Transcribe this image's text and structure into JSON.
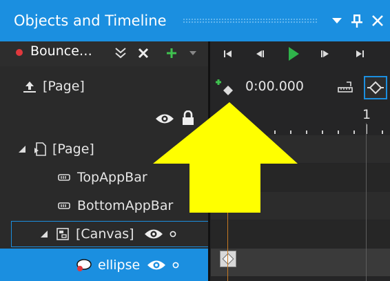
{
  "panel": {
    "title": "Objects and Timeline",
    "menu_icon": "caret-down",
    "pin_icon": "pin",
    "close_icon": "close"
  },
  "storyboard": {
    "name": "Bounce…",
    "indicator_color": "#e0383d",
    "buttons": [
      "chevrons-icon",
      "close-icon",
      "plus-icon",
      "caret-down-icon"
    ]
  },
  "transport": {
    "buttons": [
      "go-to-first-frame",
      "previous-frame",
      "play",
      "next-frame",
      "go-to-last-frame"
    ],
    "play_color": "#2fb34a"
  },
  "scope": {
    "label": "[Page]",
    "timecode": "0:00.000"
  },
  "ruler": {
    "marker_label": "1"
  },
  "tree": {
    "items": [
      {
        "label": "[Page]",
        "expanded": true,
        "icon": "page-icon"
      },
      {
        "label": "TopAppBar",
        "icon": "appbar-icon"
      },
      {
        "label": "BottomAppBar",
        "icon": "appbar-icon"
      },
      {
        "label": "[Canvas]",
        "expanded": true,
        "icon": "canvas-icon"
      },
      {
        "label": "ellipse",
        "icon": "ellipse-icon",
        "selected": true
      }
    ]
  },
  "colors": {
    "accent": "#1b8fe0",
    "annotation_arrow": "#ffff00",
    "playhead": "#c87a22"
  }
}
